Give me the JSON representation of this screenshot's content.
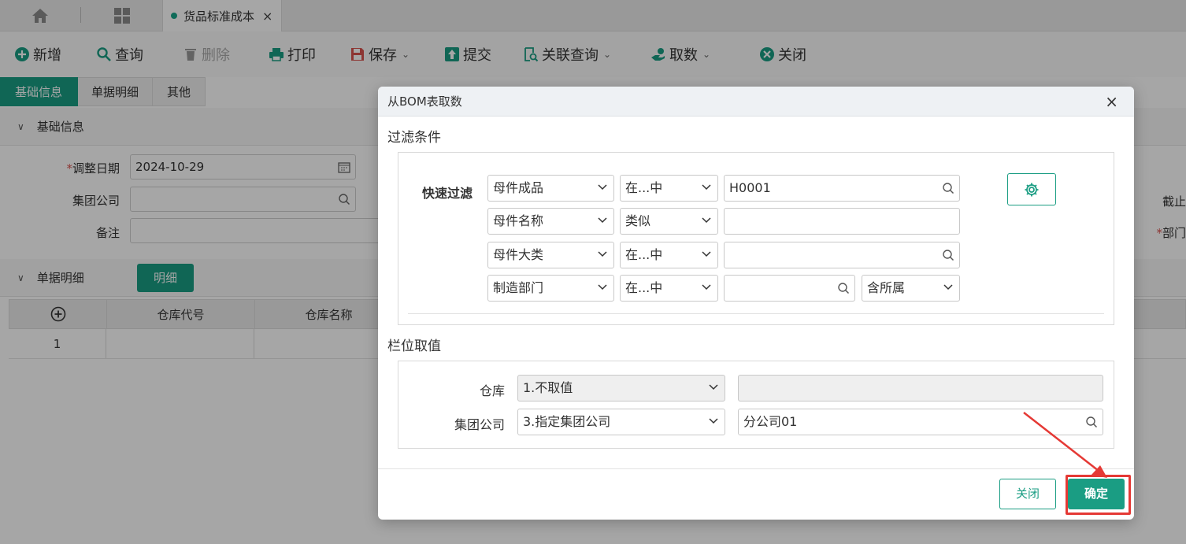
{
  "topbar": {
    "tab_title": "货品标准成本",
    "tab_close": "×"
  },
  "toolbar": {
    "add": "新增",
    "query": "查询",
    "delete": "删除",
    "print": "打印",
    "save": "保存",
    "submit": "提交",
    "related_query": "关联查询",
    "fetch": "取数",
    "close": "关闭"
  },
  "subtabs": [
    "基础信息",
    "单据明细",
    "其他"
  ],
  "basic_section": {
    "title": "基础信息",
    "adjust_date_label": "调整日期",
    "adjust_date_value": "2024-10-29",
    "group_company_label": "集团公司",
    "remark_label": "备注",
    "right_label_1": "截止",
    "right_label_2": "部门"
  },
  "detail_section": {
    "title": "单据明细",
    "detail_button": "明细",
    "columns": [
      "仓库代号",
      "仓库名称"
    ],
    "rows": [
      {
        "index": "1"
      }
    ]
  },
  "modal": {
    "title": "从BOM表取数",
    "close_icon": "×",
    "filter_section": "过滤条件",
    "quick_filter_label": "快速过滤",
    "filters": [
      {
        "field": "母件成品",
        "op": "在...中",
        "value": "H0001"
      },
      {
        "field": "母件名称",
        "op": "类似",
        "value": ""
      },
      {
        "field": "母件大类",
        "op": "在...中",
        "value": ""
      },
      {
        "field": "制造部门",
        "op": "在...中",
        "value": "",
        "extra": "含所属"
      }
    ],
    "column_section": "栏位取值",
    "column_fields": [
      {
        "label": "仓库",
        "option": "1.不取值",
        "value": ""
      },
      {
        "label": "集团公司",
        "option": "3.指定集团公司",
        "value": "分公司01"
      }
    ],
    "close_button": "关闭",
    "ok_button": "确定"
  },
  "colors": {
    "accent": "#1a9d83",
    "highlight": "#e53935"
  }
}
